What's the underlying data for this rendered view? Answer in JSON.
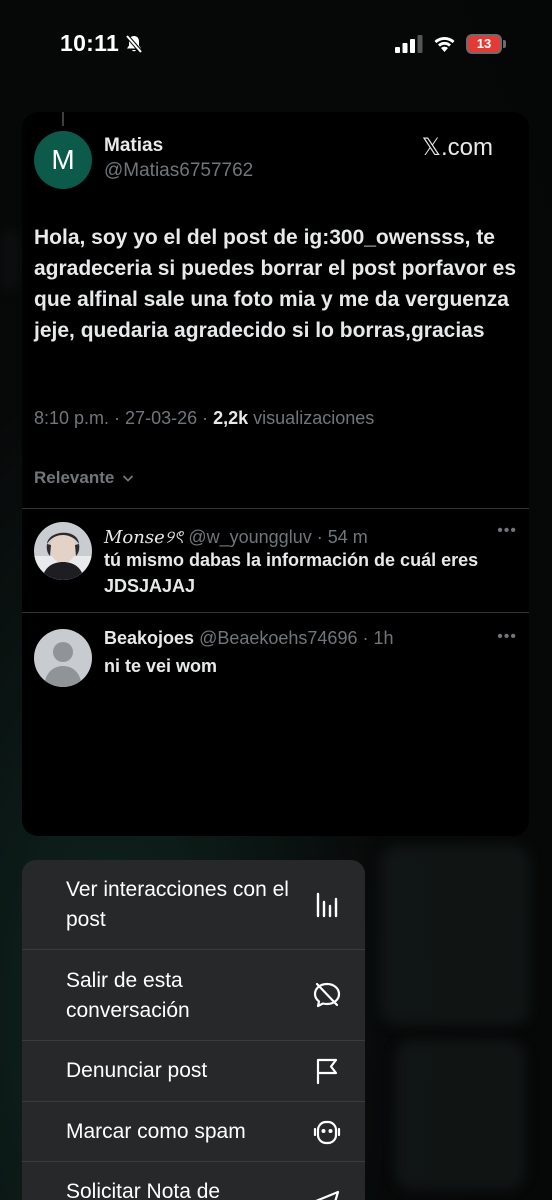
{
  "status_bar": {
    "time": "10:11",
    "battery": "13"
  },
  "post": {
    "avatar_letter": "M",
    "author_name": "Matias",
    "author_handle": "@Matias6757762",
    "source": "𝕏.com",
    "text": "Hola, soy yo el del post de ig:300_owensss, te agradeceria si puedes borrar el post porfavor es que alfinal sale una foto mia y me da verguenza jeje, quedaria agradecido si lo borras,gracias",
    "time": "8:10 p.m.",
    "date": "27-03-26",
    "views_count": "2,2k",
    "views_label": "visualizaciones",
    "sort_label": "Relevante"
  },
  "replies": [
    {
      "name": "Monse୨ৎ",
      "handle": "@w_younggluv",
      "age": "54 m",
      "text": "tú mismo dabas la información de cuál eres JDSJAJAJ"
    },
    {
      "name": "Beakojoes",
      "handle": "@Beaekoehs74696",
      "age": "1h",
      "text": "ni te vei wom"
    }
  ],
  "menu": {
    "items": [
      {
        "label": "Ver interacciones con el post",
        "icon": "chart-bars-icon"
      },
      {
        "label": "Salir de esta conversación",
        "icon": "mute-bubble-icon"
      },
      {
        "label": "Denunciar post",
        "icon": "flag-icon"
      },
      {
        "label": "Marcar como spam",
        "icon": "robot-icon"
      },
      {
        "label": "Solicitar Nota de",
        "icon": "send-icon"
      }
    ]
  },
  "colors": {
    "accent_avatar": "#0b5a4a",
    "secondary_text": "#71767b",
    "battery_low": "#e23b35",
    "menu_bg": "#262829"
  }
}
